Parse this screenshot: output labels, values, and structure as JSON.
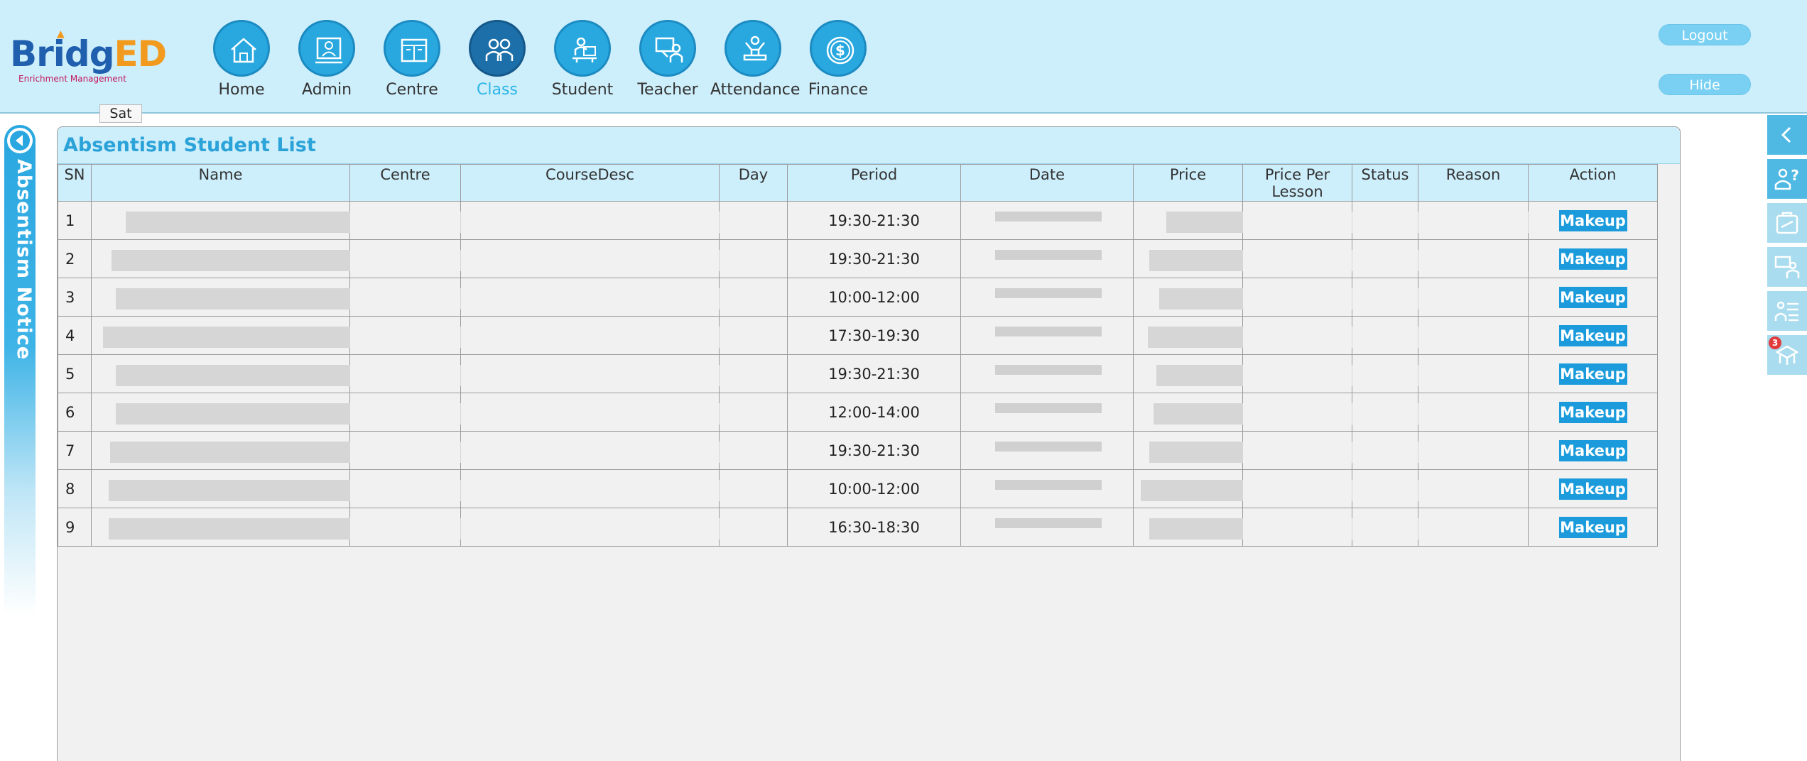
{
  "logo": {
    "wordmark_a": "Bridg",
    "wordmark_b": "ED",
    "tagline": "Enrichment Management"
  },
  "nav": {
    "items": [
      {
        "label": "Home",
        "icon": "house-icon",
        "active": false
      },
      {
        "label": "Admin",
        "icon": "admin-user-icon",
        "active": false
      },
      {
        "label": "Centre",
        "icon": "building-icon",
        "active": false
      },
      {
        "label": "Class",
        "icon": "class-group-icon",
        "active": true
      },
      {
        "label": "Student",
        "icon": "student-desk-icon",
        "active": false
      },
      {
        "label": "Teacher",
        "icon": "teacher-board-icon",
        "active": false
      },
      {
        "label": "Attendance",
        "icon": "attendance-person-icon",
        "active": false
      },
      {
        "label": "Finance",
        "icon": "dollar-coin-icon",
        "active": false
      }
    ],
    "active_color": "#2bb6e8"
  },
  "header_buttons": {
    "logout": "Logout",
    "hide": "Hide"
  },
  "tooltip": {
    "day": "Sat"
  },
  "notice_tab": {
    "label": "Absentism Notice"
  },
  "panel": {
    "title": "Absentism Student List",
    "columns": [
      "SN",
      "Name",
      "Centre",
      "CourseDesc",
      "Day",
      "Period",
      "Date",
      "Price",
      "Price Per Lesson",
      "Status",
      "Reason",
      "Action"
    ],
    "rows": [
      {
        "sn": "1",
        "period": "19:30-21:30",
        "action": "Makeup"
      },
      {
        "sn": "2",
        "period": "19:30-21:30",
        "action": "Makeup"
      },
      {
        "sn": "3",
        "period": "10:00-12:00",
        "action": "Makeup"
      },
      {
        "sn": "4",
        "period": "17:30-19:30",
        "action": "Makeup"
      },
      {
        "sn": "5",
        "period": "19:30-21:30",
        "action": "Makeup"
      },
      {
        "sn": "6",
        "period": "12:00-14:00",
        "action": "Makeup"
      },
      {
        "sn": "7",
        "period": "19:30-21:30",
        "action": "Makeup"
      },
      {
        "sn": "8",
        "period": "10:00-12:00",
        "action": "Makeup"
      },
      {
        "sn": "9",
        "period": "16:30-18:30",
        "action": "Makeup"
      }
    ]
  },
  "dock": {
    "items": [
      {
        "icon": "chevron-left-icon"
      },
      {
        "icon": "help-user-icon"
      },
      {
        "icon": "leave-plane-icon"
      },
      {
        "icon": "teacher-board-icon"
      },
      {
        "icon": "list-user-icon"
      },
      {
        "icon": "class-desk-icon",
        "badge": "3"
      }
    ]
  },
  "colors": {
    "header_bg": "#cdeefb",
    "accent": "#29a8df",
    "title": "#2ba3d8",
    "button": "#1b9bdb"
  }
}
